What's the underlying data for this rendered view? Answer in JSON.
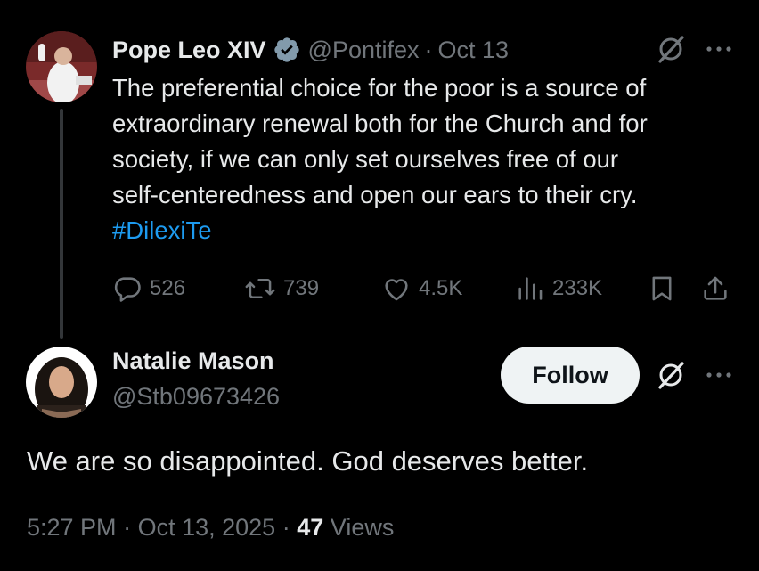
{
  "parent_tweet": {
    "display_name": "Pope Leo XIV",
    "handle": "@Pontifex",
    "separator": "·",
    "date": "Oct 13",
    "text_lines": [
      "The preferential choice for the poor is a source of",
      "extraordinary renewal both for the Church and for",
      "society, if we can only set ourselves free of our",
      "self-centeredness and open our ears to their cry."
    ],
    "hashtag": "#DilexiTe",
    "actions": {
      "replies": "526",
      "reposts": "739",
      "likes": "4.5K",
      "views": "233K"
    },
    "icons": [
      "verified-badge-icon",
      "grok-icon",
      "more-icon",
      "reply-icon",
      "repost-icon",
      "like-icon",
      "views-icon",
      "bookmark-icon",
      "share-icon"
    ]
  },
  "reply_tweet": {
    "display_name": "Natalie Mason",
    "handle": "@Stb09673426",
    "follow_label": "Follow",
    "text": "We are so disappointed. God deserves better.",
    "time": "5:27 PM",
    "separator": "·",
    "date": "Oct 13, 2025",
    "separator2": "·",
    "views_count": "47",
    "views_label": "Views"
  },
  "colors": {
    "background": "#000000",
    "primary_text": "#e7e9ea",
    "secondary_text": "#71767b",
    "link": "#1d9bf0",
    "verified": "#829aab",
    "follow_bg": "#eff3f4"
  }
}
